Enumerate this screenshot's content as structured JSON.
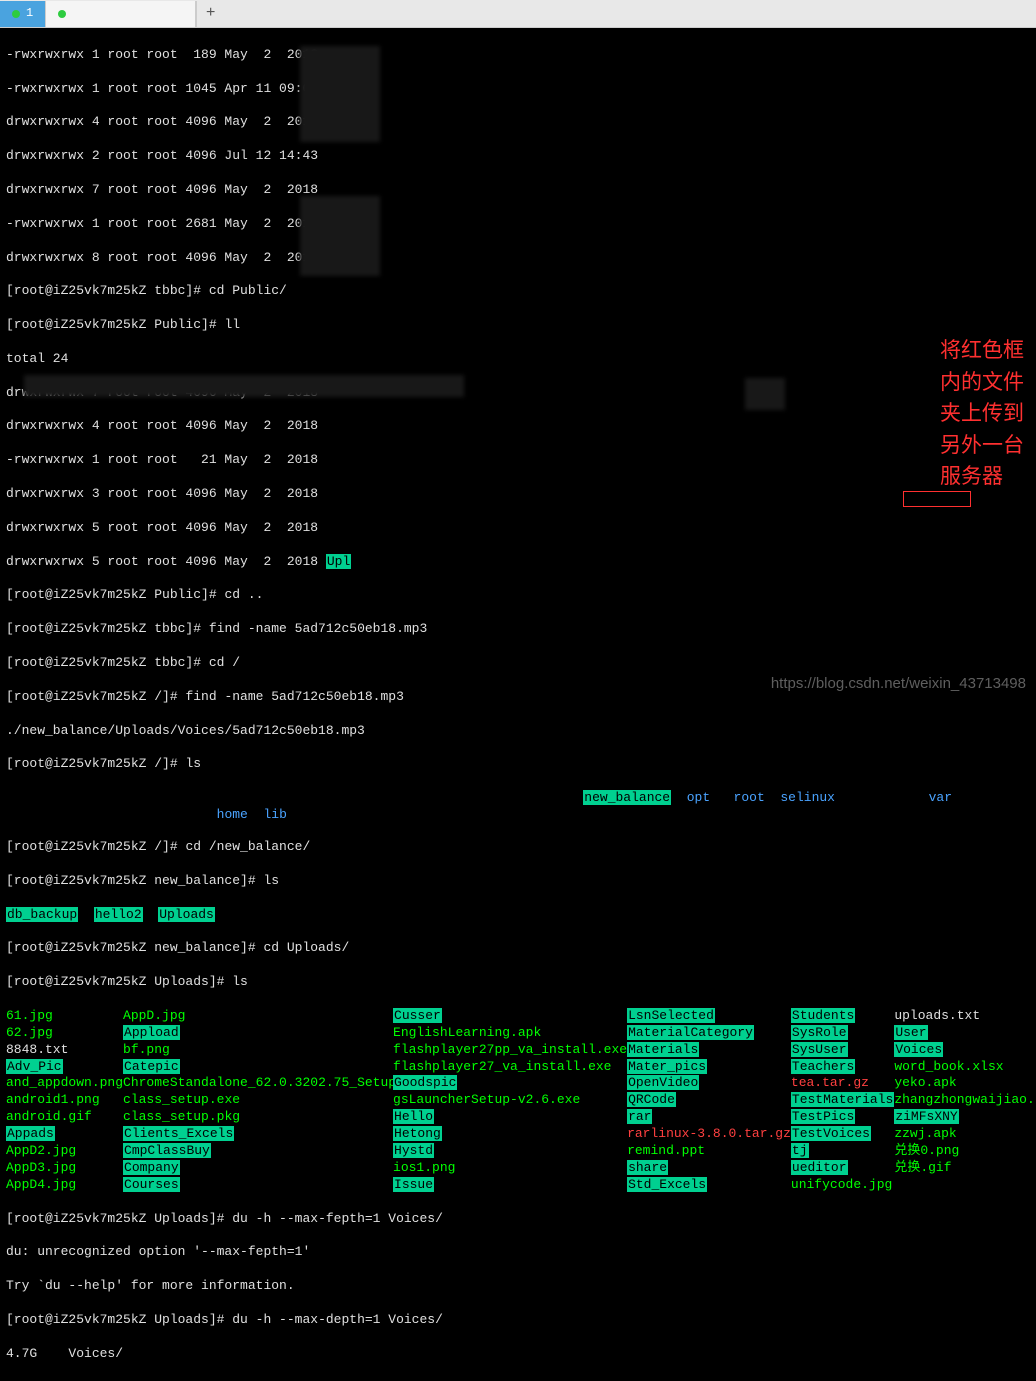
{
  "tabs": {
    "tab1": "1",
    "tab2": "",
    "add": "+"
  },
  "annotation": {
    "l1": "将红色框",
    "l2": "内的文件",
    "l3": "夹上传到",
    "l4": "另外一台",
    "l5": "服务器"
  },
  "lines": {
    "l0": "-rwxrwxrwx 1 root root  189 May  2  2018 ",
    "l1": "-rwxrwxrwx 1 root root 1045 Apr 11 09:06 ",
    "l2": "drwxrwxrwx 4 root root 4096 May  2  2018 ",
    "l3": "drwxrwxrwx 2 root root 4096 Jul 12 14:43 ",
    "l4": "drwxrwxrwx 7 root root 4096 May  2  2018 ",
    "l5": "-rwxrwxrwx 1 root root 2681 May  2  2018 ",
    "l6": "drwxrwxrwx 8 root root 4096 May  2  2018 ",
    "l7p": "[root@iZ25vk7m25kZ tbbc]# ",
    "l7c": "cd Public/",
    "l8p": "[root@iZ25vk7m25kZ Public]# ",
    "l8c": "ll",
    "l9": "total 24",
    "l10": "drwxrwxrwx 7 root root 4096 May  2  2018 ",
    "l11": "drwxrwxrwx 4 root root 4096 May  2  2018 ",
    "l12": "-rwxrwxrwx 1 root root   21 May  2  2018 ",
    "l13": "drwxrwxrwx 3 root root 4096 May  2  2018 ",
    "l14": "drwxrwxrwx 5 root root 4096 May  2  2018 ",
    "l15": "drwxrwxrwx 5 root root 4096 May  2  2018 ",
    "l15a": "Upl",
    "l16p": "[root@iZ25vk7m25kZ Public]# ",
    "l16c": "cd ..",
    "l17p": "[root@iZ25vk7m25kZ tbbc]# ",
    "l17c": "find -name 5ad712c50eb18.mp3",
    "l18p": "[root@iZ25vk7m25kZ tbbc]# ",
    "l18c": "cd /",
    "l19p": "[root@iZ25vk7m25kZ /]# ",
    "l19c": "find -name 5ad712c50eb18.mp3",
    "l20": "./new_balance/Uploads/Voices/5ad712c50eb18.mp3",
    "l21p": "[root@iZ25vk7m25kZ /]# ",
    "l21c": "ls",
    "dirs_home": "home",
    "dirs_lib": "lib",
    "dirs_nb": "new_balance",
    "dirs_opt": "opt",
    "dirs_root": "root",
    "dirs_selinux": "selinux",
    "dirs_var": "var",
    "l23p": "[root@iZ25vk7m25kZ /]# ",
    "l23c": "cd /new_balance/",
    "l24p": "[root@iZ25vk7m25kZ new_balance]# ",
    "l24c": "ls",
    "l25a": "db_backup",
    "l25b": "hello2",
    "l25c": "Uploads",
    "l26p": "[root@iZ25vk7m25kZ new_balance]# ",
    "l26c": "cd Uploads/",
    "l27p": "[root@iZ25vk7m25kZ Uploads]# ",
    "l27c": "ls"
  },
  "uploads": {
    "c1": [
      "61.jpg",
      "62.jpg",
      "8848.txt",
      "Adv_Pic",
      "and_appdown.png",
      "android1.png",
      "android.gif",
      "Appads",
      "AppD2.jpg",
      "AppD3.jpg",
      "AppD4.jpg"
    ],
    "c1cls": [
      "green",
      "green",
      "white",
      "greenbg",
      "green",
      "green",
      "green",
      "greenbg",
      "green",
      "green",
      "green"
    ],
    "c2": [
      "AppD.jpg",
      "Appload",
      "bf.png",
      "Catepic",
      "ChromeStandalone_62.0.3202.75_Setup.exe",
      "class_setup.exe",
      "class_setup.pkg",
      "Clients_Excels",
      "CmpClassBuy",
      "Company",
      "Courses"
    ],
    "c2cls": [
      "green",
      "greenbg",
      "green",
      "greenbg",
      "green",
      "green",
      "green",
      "greenbg",
      "greenbg",
      "greenbg",
      "greenbg"
    ],
    "c3": [
      "Cusser",
      "EnglishLearning.apk",
      "flashplayer27pp_va_install.exe",
      "flashplayer27_va_install.exe",
      "Goodspic",
      "gsLauncherSetup-v2.6.exe",
      "Hello",
      "Hetong",
      "Hystd",
      "ios1.png",
      "Issue"
    ],
    "c3cls": [
      "greenbg",
      "green",
      "green",
      "green",
      "greenbg",
      "green",
      "greenbg",
      "greenbg",
      "greenbg",
      "green",
      "greenbg"
    ],
    "c4": [
      "LsnSelected",
      "MaterialCategory",
      "Materials",
      "Mater_pics",
      "OpenVideo",
      "QRCode",
      "rar",
      "rarlinux-3.8.0.tar.gz",
      "remind.ppt",
      "share",
      "Std_Excels"
    ],
    "c4cls": [
      "greenbg",
      "greenbg",
      "greenbg",
      "greenbg",
      "greenbg",
      "greenbg",
      "greenbg",
      "red",
      "green",
      "greenbg",
      "greenbg"
    ],
    "c5": [
      "Students",
      "SysRole",
      "SysUser",
      "Teachers",
      "tea.tar.gz",
      "TestMaterials",
      "TestPics",
      "TestVoices",
      "tj",
      "ueditor",
      "unifycode.jpg"
    ],
    "c5cls": [
      "greenbg",
      "greenbg",
      "greenbg",
      "greenbg",
      "red",
      "greenbg",
      "greenbg",
      "greenbg",
      "greenbg",
      "greenbg",
      "green"
    ],
    "c6": [
      "uploads.txt",
      "User",
      "Voices",
      "word_book.xlsx",
      "yeko.apk",
      "zhangzhongwaijiao.",
      "ziMFsXNY",
      "zzwj.apk",
      "兑换0.png",
      "兑换.gif",
      ""
    ],
    "c6cls": [
      "white",
      "greenbg",
      "greenbg",
      "green",
      "green",
      "green",
      "greenbg",
      "green",
      "green",
      "green",
      "white"
    ]
  },
  "tail": {
    "l1p": "[root@iZ25vk7m25kZ Uploads]# ",
    "l1c": "du -h --max-fepth=1 Voices/",
    "l2": "du: unrecognized option '--max-fepth=1'",
    "l3": "Try `du --help' for more information.",
    "l4p": "[root@iZ25vk7m25kZ Uploads]# ",
    "l4c": "du -h --max-depth=1 Voices/",
    "l5": "4.7G    Voices/"
  },
  "watermark": "https://blog.csdn.net/weixin_43713498"
}
